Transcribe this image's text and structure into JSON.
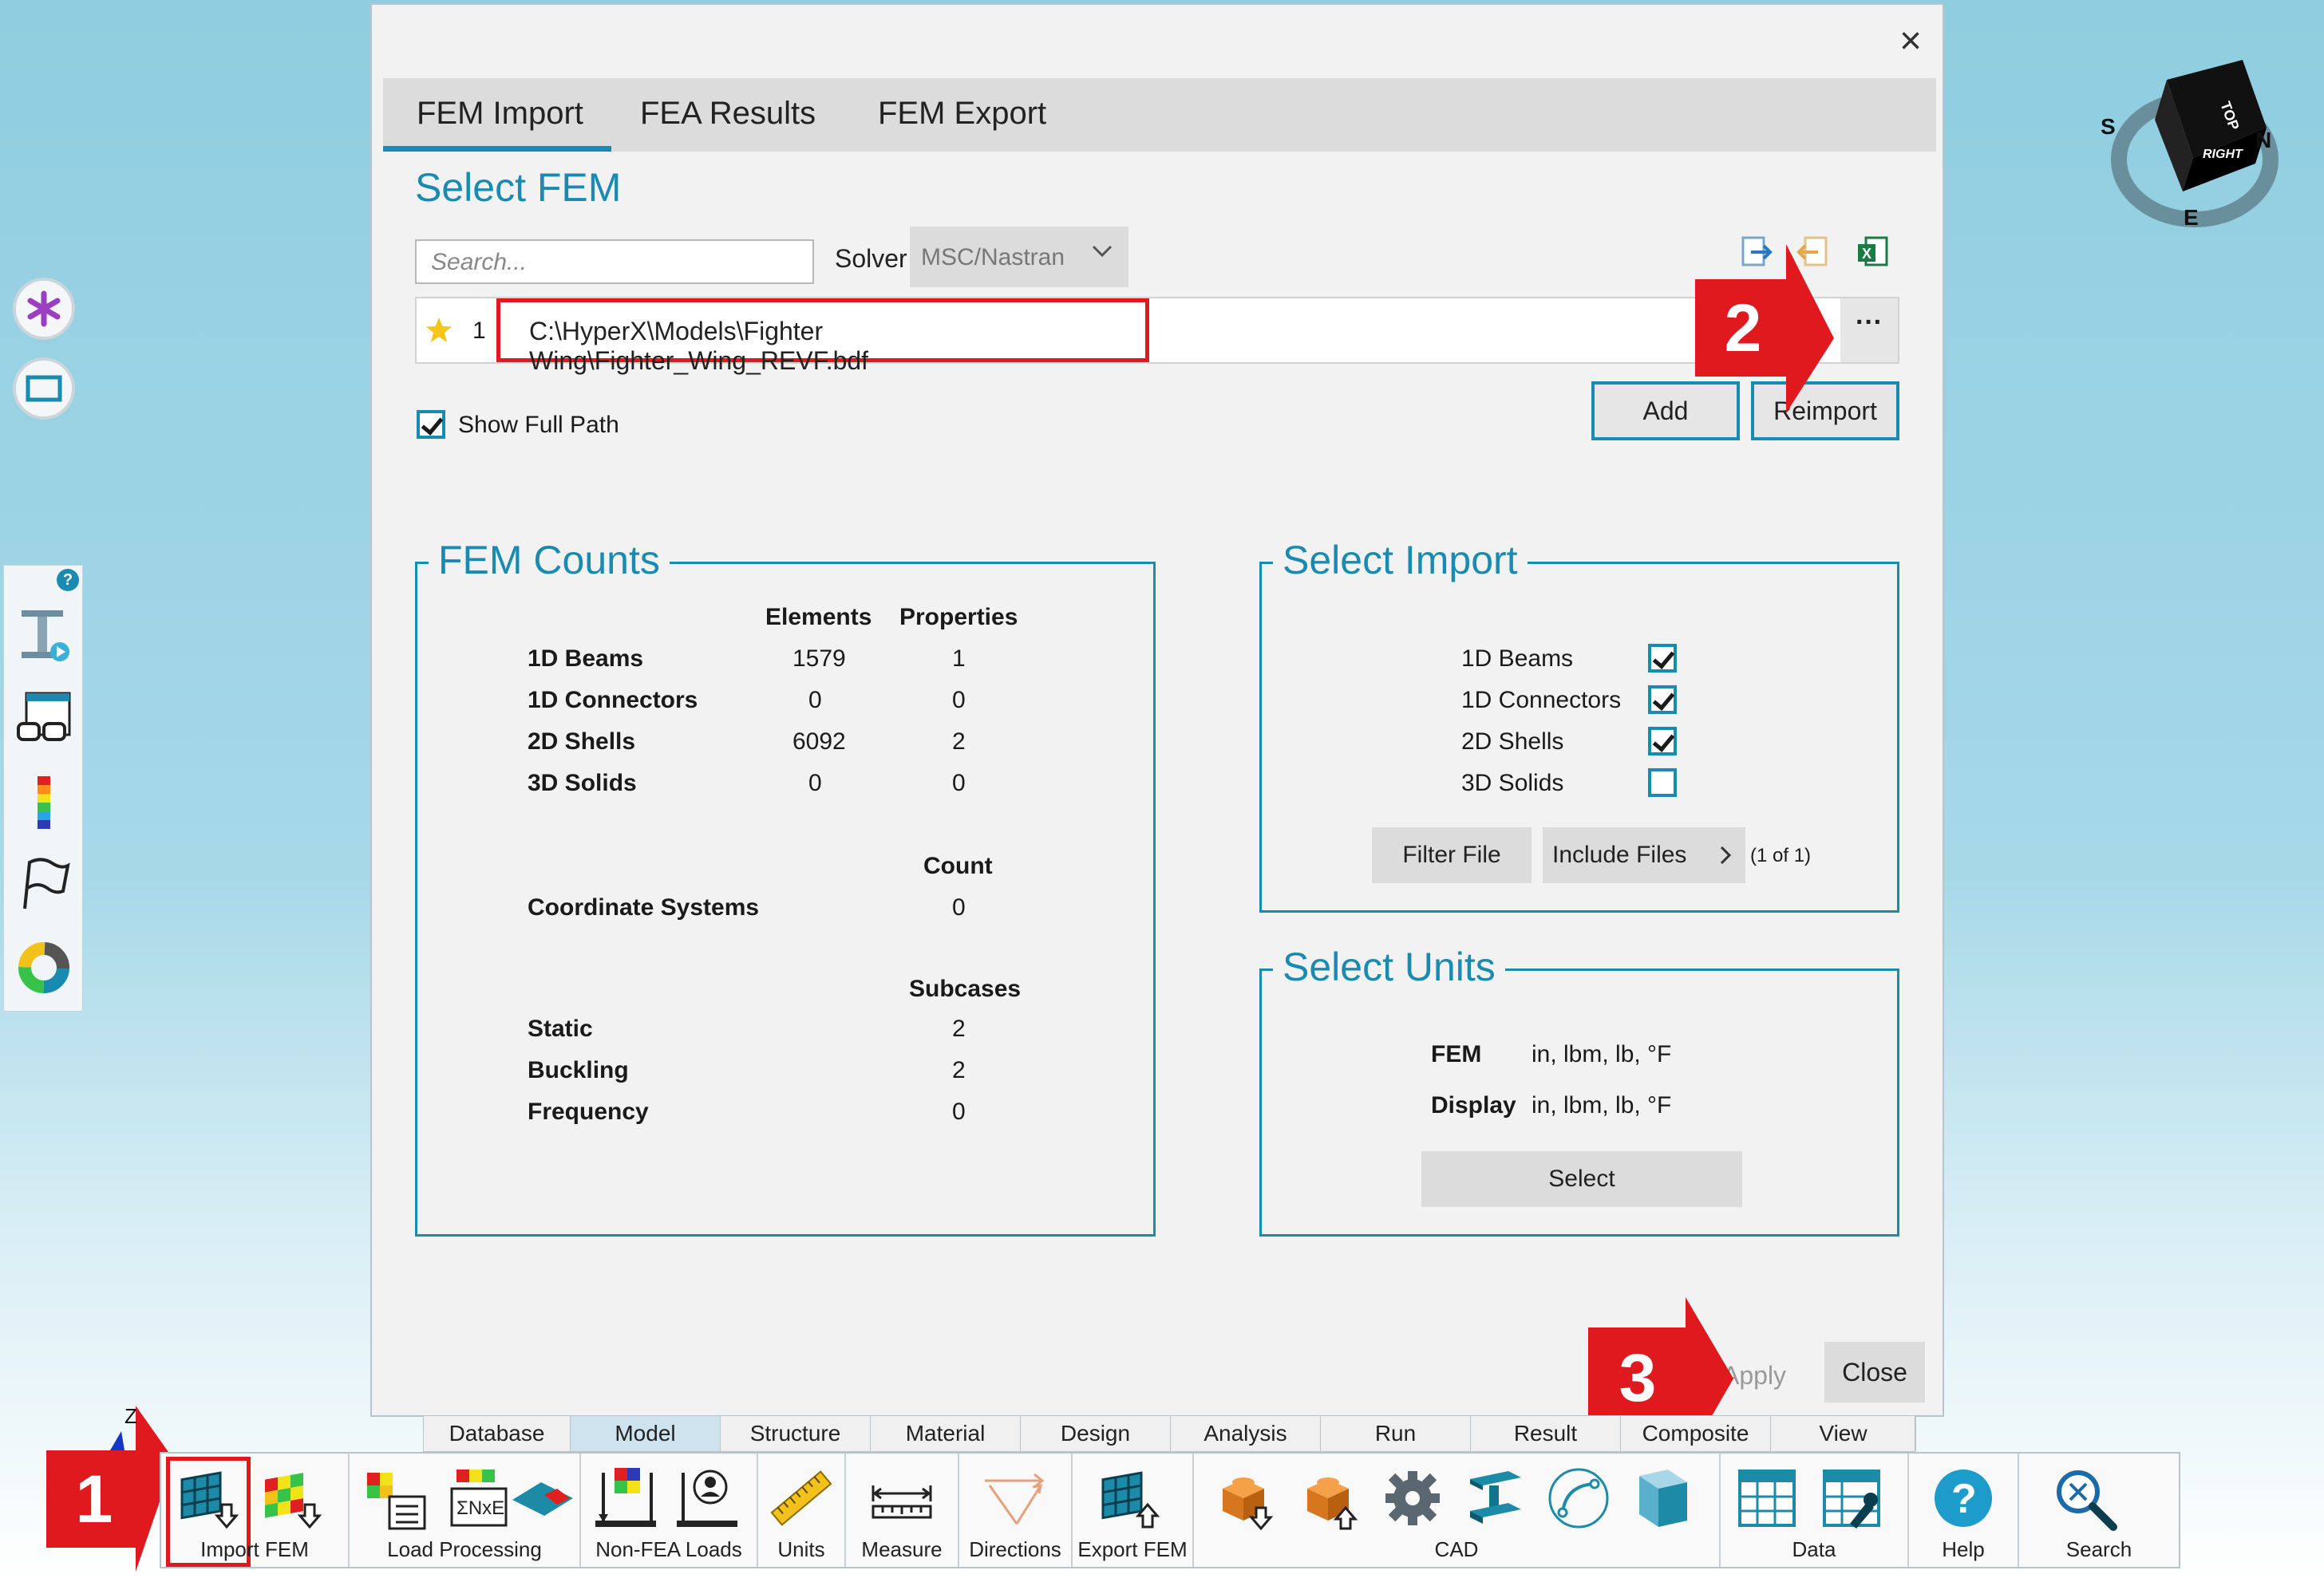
{
  "dialog": {
    "close_icon": "×",
    "tabs": [
      "FEM Import",
      "FEA Results",
      "FEM Export"
    ],
    "active_tab": "FEM Import",
    "select_fem_title": "Select FEM",
    "search_placeholder": "Search...",
    "solver_label": "Solver",
    "solver_value": "MSC/Nastran",
    "file_row": {
      "index": "1",
      "path": "C:\\HyperX\\Models\\Fighter Wing\\Fighter_Wing_REVF.bdf",
      "more": "···"
    },
    "add_label": "Add",
    "reimport_label": "Reimport",
    "show_full_path_label": "Show Full Path",
    "show_full_path_checked": true,
    "fem_counts": {
      "title": "FEM Counts",
      "col_elements": "Elements",
      "col_properties": "Properties",
      "rows": [
        {
          "label": "1D Beams",
          "elements": "1579",
          "properties": "1"
        },
        {
          "label": "1D Connectors",
          "elements": "0",
          "properties": "0"
        },
        {
          "label": "2D Shells",
          "elements": "6092",
          "properties": "2"
        },
        {
          "label": "3D Solids",
          "elements": "0",
          "properties": "0"
        }
      ],
      "col_count": "Count",
      "coord_label": "Coordinate Systems",
      "coord_count": "0",
      "col_subcases": "Subcases",
      "subcases": [
        {
          "label": "Static",
          "value": "2"
        },
        {
          "label": "Buckling",
          "value": "2"
        },
        {
          "label": "Frequency",
          "value": "0"
        }
      ]
    },
    "select_import": {
      "title": "Select Import",
      "items": [
        {
          "label": "1D Beams",
          "checked": true
        },
        {
          "label": "1D Connectors",
          "checked": true
        },
        {
          "label": "2D Shells",
          "checked": true
        },
        {
          "label": "3D Solids",
          "checked": false
        }
      ],
      "filter_file": "Filter File",
      "include_files": "Include Files",
      "include_count": "(1 of 1)"
    },
    "select_units": {
      "title": "Select Units",
      "fem_label": "FEM",
      "fem_value": "in, lbm, lb, °F",
      "display_label": "Display",
      "display_value": "in, lbm, lb, °F",
      "select_button": "Select"
    },
    "apply_label": "Apply",
    "close_label": "Close"
  },
  "badges": {
    "one": "1",
    "two": "2",
    "three": "3"
  },
  "viewcube": {
    "top": "TOP",
    "right": "RIGHT",
    "s": "S",
    "n": "N",
    "e": "E"
  },
  "axis_label": "Z",
  "help_badge": "?",
  "ribbon": {
    "tabs": [
      "Database",
      "Model",
      "Structure",
      "Material",
      "Design",
      "Analysis",
      "Run",
      "Result",
      "Composite",
      "View"
    ],
    "active_tab": "Model",
    "groups": [
      "Import FEM",
      "Load Processing",
      "Non-FEA Loads",
      "Units",
      "Measure",
      "Directions",
      "Export FEM",
      "CAD",
      "Data",
      "Help",
      "Search"
    ]
  },
  "colors": {
    "accent": "#1a8bb0",
    "highlight": "#e0191f"
  }
}
